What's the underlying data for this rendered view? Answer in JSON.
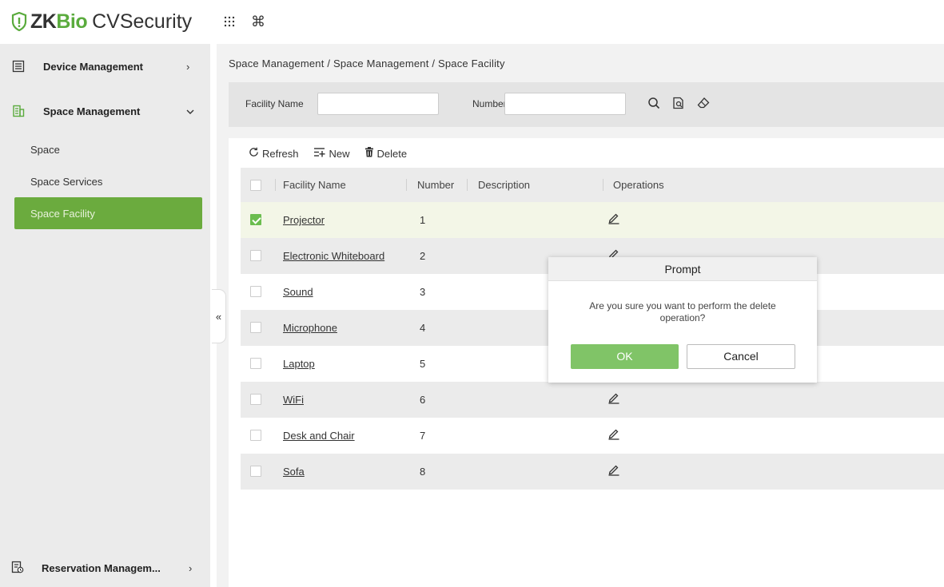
{
  "app": {
    "brand_zk": "ZK",
    "brand_bio": "Bio",
    "product": "CVSecurity",
    "accent_color": "#6bab3e",
    "top_icons": [
      "grid-icon",
      "command-icon"
    ]
  },
  "sidebar": {
    "device_management": "Device Management",
    "space_management": "Space Management",
    "sub_items": [
      "Space",
      "Space Services",
      "Space Facility"
    ],
    "active_sub_item": "Space Facility",
    "reservation_management": "Reservation Managem..."
  },
  "breadcrumb": "Space Management / Space Management / Space Facility",
  "search": {
    "facility_name_label": "Facility Name",
    "facility_name_value": "",
    "number_label": "Number",
    "number_value": ""
  },
  "toolbar": {
    "refresh": "Refresh",
    "new": "New",
    "delete": "Delete"
  },
  "table": {
    "headers": [
      "Facility Name",
      "Number",
      "Description",
      "Operations"
    ],
    "rows": [
      {
        "name": "Projector",
        "number": "1",
        "description": "",
        "checked": true
      },
      {
        "name": "Electronic Whiteboard",
        "number": "2",
        "description": "",
        "checked": false
      },
      {
        "name": "Sound",
        "number": "3",
        "description": "",
        "checked": false
      },
      {
        "name": "Microphone",
        "number": "4",
        "description": "",
        "checked": false
      },
      {
        "name": "Laptop",
        "number": "5",
        "description": "",
        "checked": false
      },
      {
        "name": "WiFi",
        "number": "6",
        "description": "",
        "checked": false
      },
      {
        "name": "Desk and Chair",
        "number": "7",
        "description": "",
        "checked": false
      },
      {
        "name": "Sofa",
        "number": "8",
        "description": "",
        "checked": false
      }
    ]
  },
  "modal": {
    "title": "Prompt",
    "message": "Are you sure you want to perform the delete operation?",
    "ok": "OK",
    "cancel": "Cancel"
  }
}
